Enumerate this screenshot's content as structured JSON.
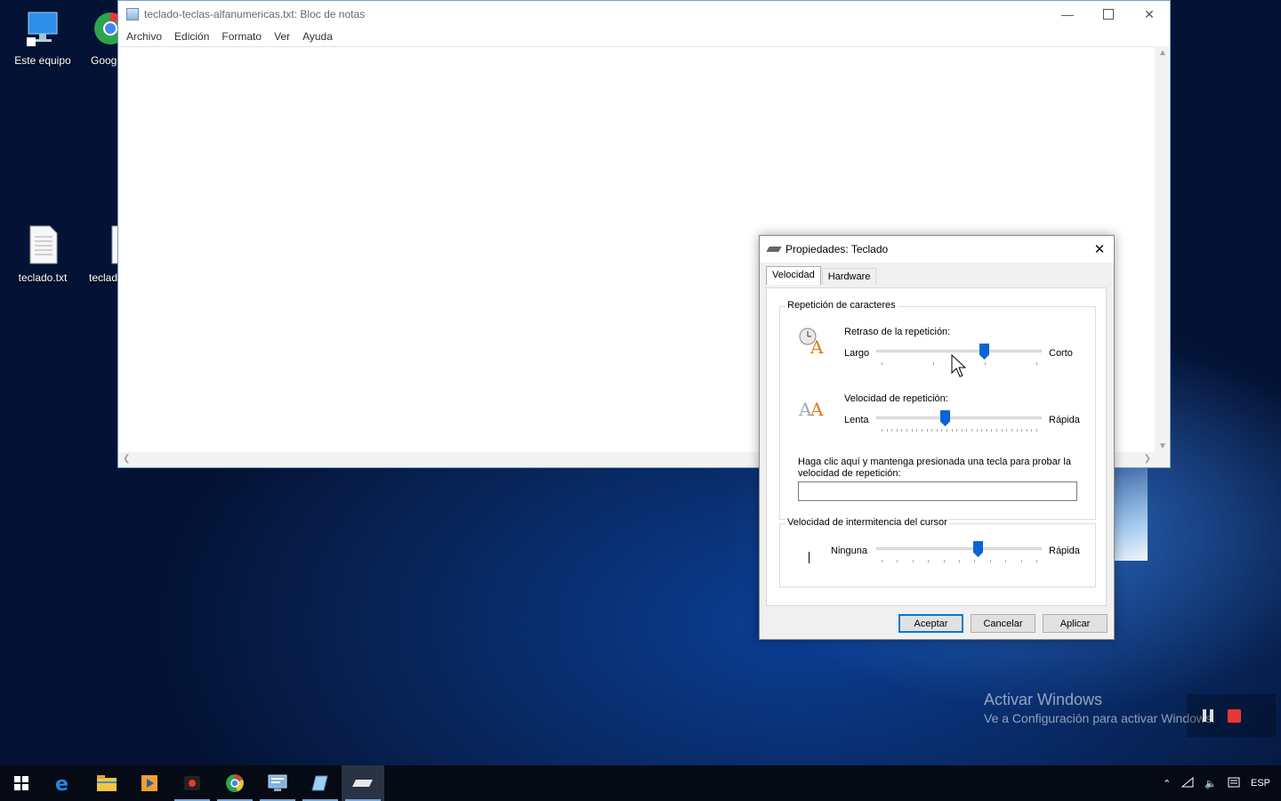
{
  "desktop": {
    "icons": [
      {
        "label": "Este equipo"
      },
      {
        "label": "Goog"
      },
      {
        "label": "teclado.txt"
      },
      {
        "label": "teclad"
      }
    ]
  },
  "notepad": {
    "title": "teclado-teclas-alfanumericas.txt: Bloc de notas",
    "menu": [
      "Archivo",
      "Edición",
      "Formato",
      "Ver",
      "Ayuda"
    ]
  },
  "dialog": {
    "title": "Propiedades: Teclado",
    "tabs": [
      "Velocidad",
      "Hardware"
    ],
    "repeat_group": {
      "label": "Repetición de caracteres",
      "delay": {
        "label": "Retraso de la repetición:",
        "min": "Largo",
        "max": "Corto",
        "level": 0.66,
        "ticks": 4
      },
      "rate": {
        "label": "Velocidad de repetición:",
        "min": "Lenta",
        "max": "Rápida",
        "level": 0.41,
        "ticks": 32
      },
      "test_label": "Haga clic aquí y mantenga presionada una tecla para probar la velocidad de repetición:",
      "test_value": ""
    },
    "blink_group": {
      "label": "Velocidad de intermitencia del cursor",
      "min": "Ninguna",
      "max": "Rápida",
      "level": 0.62,
      "ticks": 11
    },
    "buttons": {
      "ok": "Aceptar",
      "cancel": "Cancelar",
      "apply": "Aplicar"
    }
  },
  "watermark": {
    "line1": "Activar Windows",
    "line2": "Ve a Configuración para activar Windows."
  },
  "taskbar": {
    "apps": [
      "start-icon",
      "edge-icon",
      "file-explorer-icon",
      "media-player-icon",
      "screen-recorder-icon",
      "chrome-icon",
      "control-panel-icon",
      "notepad-icon",
      "keyboard-icon"
    ],
    "language": "ESP"
  },
  "colors": {
    "accent": "#0078d7",
    "slider_thumb": "#0a64d8",
    "taskbar": "#050a14"
  }
}
